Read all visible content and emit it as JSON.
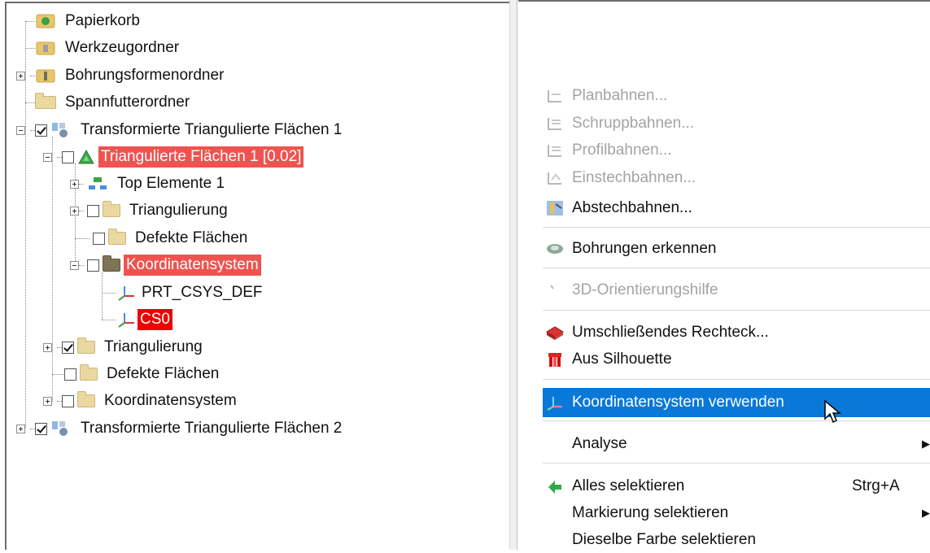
{
  "tree": {
    "items": [
      {
        "label": "Papierkorb"
      },
      {
        "label": "Werkzeugordner"
      },
      {
        "label": "Bohrungsformenordner"
      },
      {
        "label": "Spannfutterordner"
      },
      {
        "label": "Transformierte Triangulierte Flächen 1"
      },
      {
        "label": "Triangulierte Flächen 1 [0.02]"
      },
      {
        "label": "Top Elemente 1"
      },
      {
        "label": "Triangulierung"
      },
      {
        "label": "Defekte Flächen"
      },
      {
        "label": "Koordinatensystem"
      },
      {
        "label": "PRT_CSYS_DEF"
      },
      {
        "label": "CS0"
      },
      {
        "label": "Triangulierung"
      },
      {
        "label": "Defekte Flächen"
      },
      {
        "label": "Koordinatensystem"
      },
      {
        "label": "Transformierte Triangulierte Flächen 2"
      }
    ]
  },
  "context_menu": {
    "items": [
      {
        "label": "Planbahnen...",
        "icon": "planbahnen-icon"
      },
      {
        "label": "Schruppbahnen...",
        "icon": "schruppbahnen-icon"
      },
      {
        "label": "Profilbahnen...",
        "icon": "profilbahnen-icon"
      },
      {
        "label": "Einstechbahnen...",
        "icon": "einstechbahnen-icon"
      },
      {
        "label": "Abstechbahnen...",
        "icon": "abstechbahnen-icon"
      },
      {
        "label": "Bohrungen erkennen",
        "icon": "bohrungen-icon"
      },
      {
        "label": "3D-Orientierungshilfe",
        "icon": "orientierung-icon"
      },
      {
        "label": "Umschließendes Rechteck...",
        "icon": "rechteck-icon"
      },
      {
        "label": "Aus Silhouette",
        "icon": "silhouette-icon"
      },
      {
        "label": "Koordinatensystem verwenden",
        "icon": "koordinatensystem-icon"
      },
      {
        "label": "Analyse"
      },
      {
        "label": "Alles selektieren",
        "icon": "select-all-icon",
        "shortcut": "Strg+A"
      },
      {
        "label": "Markierung selektieren"
      },
      {
        "label": "Dieselbe Farbe selektieren"
      }
    ]
  },
  "colors": {
    "highlight_red": "#ef5350",
    "highlight_red_strong": "#ee0000",
    "menu_active": "#0a78d7",
    "disabled_text": "#a3a3a3"
  }
}
